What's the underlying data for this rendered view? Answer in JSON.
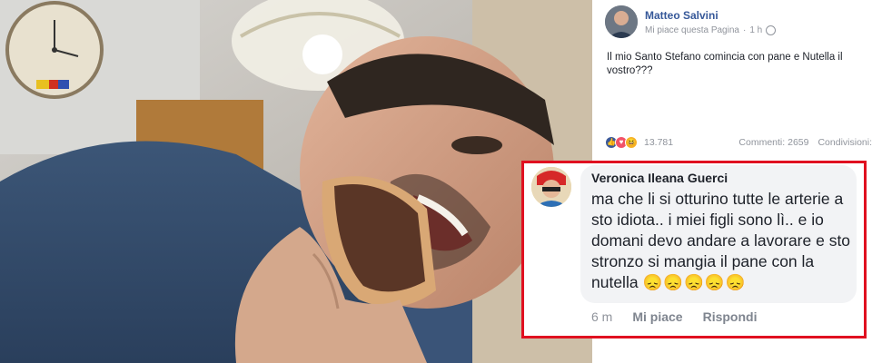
{
  "post": {
    "author": "Matteo Salvini",
    "page_like_label": "Mi piace questa Pagina",
    "time": "1 h",
    "text": "Il mio Santo Stefano comincia con pane e Nutella il vostro???",
    "reactions_count": "13.781",
    "comments_label": "Commenti: 2659",
    "shares_label": "Condivisioni:"
  },
  "comment": {
    "author": "Veronica Ileana Guerci",
    "text": "ma che li si otturino tutte le arterie a sto idiota.. i miei figli sono lì.. e io domani devo andare a lavorare e sto stronzo si mangia il pane con la nutella",
    "emojis": "😞😞😞😞😞",
    "time": "6 m",
    "like_label": "Mi piace",
    "reply_label": "Rispondi"
  },
  "colors": {
    "highlight_border": "#e01020",
    "link_blue": "#365899"
  }
}
